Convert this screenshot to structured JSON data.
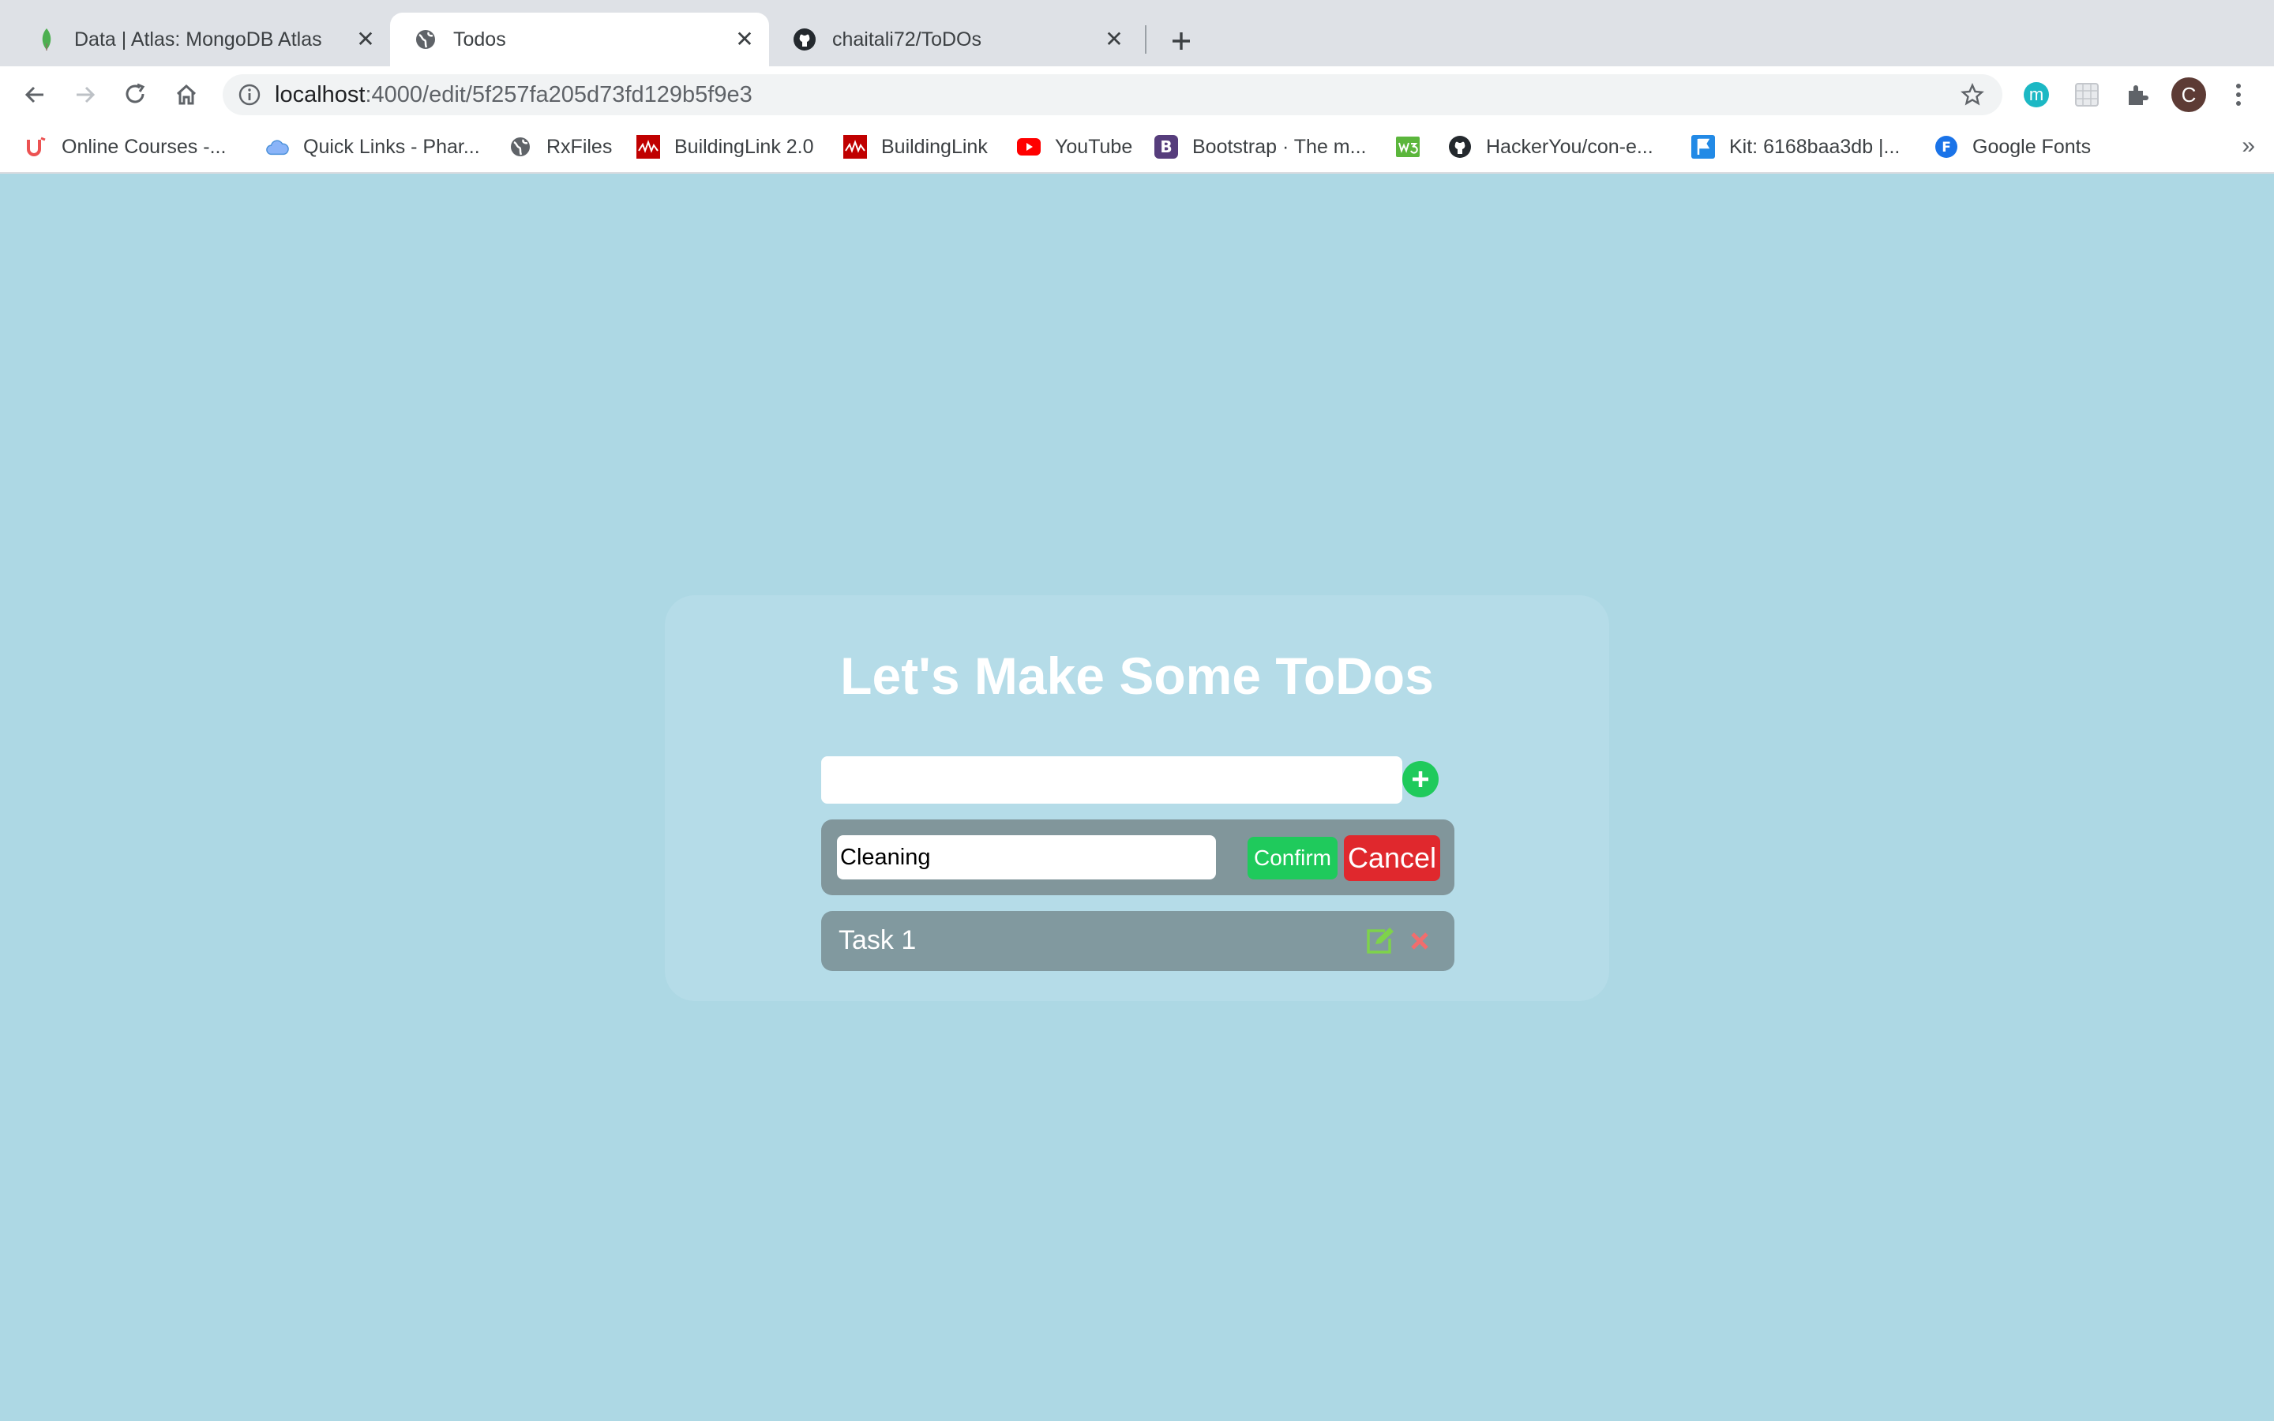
{
  "browser": {
    "tabs": [
      {
        "title": "Data | Atlas: MongoDB Atlas",
        "icon": "mongodb-leaf-icon",
        "active": false
      },
      {
        "title": "Todos",
        "icon": "globe-icon",
        "active": true
      },
      {
        "title": "chaitali72/ToDOs",
        "icon": "github-icon",
        "active": false
      }
    ],
    "url_host": "localhost",
    "url_path": ":4000/edit/5f257fa205d73fd129b5f9e3",
    "profile_initial": "C",
    "extension_initial": "m",
    "bookmarks": [
      {
        "label": "Online Courses -...",
        "icon": "udemy-icon"
      },
      {
        "label": "Quick Links - Phar...",
        "icon": "cloud-icon"
      },
      {
        "label": "RxFiles",
        "icon": "globe-icon"
      },
      {
        "label": "BuildingLink 2.0",
        "icon": "buildinglink-icon"
      },
      {
        "label": "BuildingLink",
        "icon": "buildinglink-icon"
      },
      {
        "label": "YouTube",
        "icon": "youtube-icon"
      },
      {
        "label": "Bootstrap · The m...",
        "icon": "bootstrap-icon"
      },
      {
        "label": "",
        "icon": "w3-icon"
      },
      {
        "label": "HackerYou/con-e...",
        "icon": "github-icon"
      },
      {
        "label": "Kit: 6168baa3db |...",
        "icon": "fontawesome-flag-icon"
      },
      {
        "label": "Google Fonts",
        "icon": "google-fonts-icon"
      }
    ],
    "bookmarks_overflow": "»"
  },
  "app": {
    "title": "Let's Make Some ToDos",
    "new_todo_value": "",
    "editing": {
      "value": "Cleaning",
      "confirm_label": "Confirm",
      "cancel_label": "Cancel"
    },
    "todos": [
      {
        "text": "Task 1"
      }
    ]
  },
  "colors": {
    "page_background": "#add8e4",
    "card_background": "#b5dce8",
    "row_background": "#81969b",
    "confirm_green": "#1fca5c",
    "cancel_red": "#e0282d",
    "edit_icon_green": "#7ed34a",
    "delete_icon_red": "#f26d6d"
  }
}
